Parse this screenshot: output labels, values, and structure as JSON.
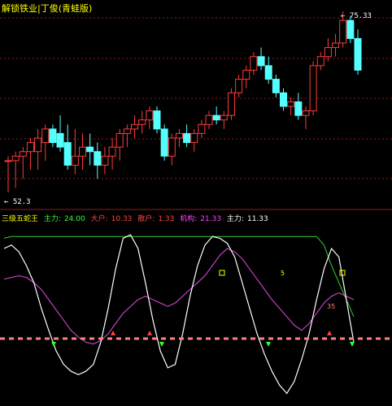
{
  "upper_panel": {
    "title": "解锁铁业|丁俊(青蛙版)",
    "high_label": "← 75.33",
    "low_label": "← 52.3",
    "colors": {
      "up": "#ff3b3b",
      "down": "#54ffff",
      "grid": "#8a1e1e",
      "title": "#ffff00"
    }
  },
  "lower_panel": {
    "indicator_name": "三级五蛇王",
    "fields": [
      {
        "label": "主力:",
        "value": "24.00",
        "color": "#33ff33"
      },
      {
        "label": "大户:",
        "value": "10.33",
        "color": "#ff4444"
      },
      {
        "label": "散户:",
        "value": "1.33",
        "color": "#ff4444"
      },
      {
        "label": "机构:",
        "value": "21.33",
        "color": "#ff44ff"
      },
      {
        "label": "主力:",
        "value": "11.33",
        "color": "#ffffff"
      }
    ],
    "marker_labels": [
      "5",
      "35"
    ],
    "colors": {
      "white_line": "#ffffff",
      "magenta_line": "#c040c0",
      "green_line": "#33cc33",
      "dash_line": "#ff8080",
      "buy_arrow": "#33ff33",
      "sell_arrow": "#ff4040"
    }
  },
  "chart_data": {
    "type": "candlestick",
    "candles": [
      {
        "o": 64,
        "h": 65,
        "l": 57,
        "c": 64
      },
      {
        "o": 64,
        "h": 66,
        "l": 58,
        "c": 65
      },
      {
        "o": 65,
        "h": 67,
        "l": 60,
        "c": 66
      },
      {
        "o": 66,
        "h": 69,
        "l": 62,
        "c": 68
      },
      {
        "o": 66,
        "h": 71,
        "l": 62,
        "c": 69
      },
      {
        "o": 68,
        "h": 72,
        "l": 64,
        "c": 71
      },
      {
        "o": 71,
        "h": 72,
        "l": 67,
        "c": 68
      },
      {
        "o": 70,
        "h": 74,
        "l": 66,
        "c": 67
      },
      {
        "o": 68,
        "h": 72,
        "l": 62,
        "c": 63
      },
      {
        "o": 63,
        "h": 71,
        "l": 61,
        "c": 65
      },
      {
        "o": 65,
        "h": 70,
        "l": 62,
        "c": 67
      },
      {
        "o": 67,
        "h": 70,
        "l": 63,
        "c": 66
      },
      {
        "o": 66,
        "h": 68,
        "l": 60,
        "c": 63
      },
      {
        "o": 63,
        "h": 67,
        "l": 61,
        "c": 65
      },
      {
        "o": 65,
        "h": 69,
        "l": 62,
        "c": 67
      },
      {
        "o": 67,
        "h": 71,
        "l": 64,
        "c": 70
      },
      {
        "o": 70,
        "h": 72,
        "l": 67,
        "c": 71
      },
      {
        "o": 71,
        "h": 74,
        "l": 69,
        "c": 72
      },
      {
        "o": 72,
        "h": 75,
        "l": 70,
        "c": 73
      },
      {
        "o": 73,
        "h": 76,
        "l": 71,
        "c": 75
      },
      {
        "o": 75,
        "h": 76,
        "l": 70,
        "c": 71
      },
      {
        "o": 71,
        "h": 72,
        "l": 64,
        "c": 65
      },
      {
        "o": 65,
        "h": 70,
        "l": 63,
        "c": 69
      },
      {
        "o": 69,
        "h": 71,
        "l": 67,
        "c": 70
      },
      {
        "o": 70,
        "h": 72,
        "l": 67,
        "c": 68
      },
      {
        "o": 68,
        "h": 71,
        "l": 66,
        "c": 70
      },
      {
        "o": 70,
        "h": 73,
        "l": 69,
        "c": 72
      },
      {
        "o": 72,
        "h": 75,
        "l": 71,
        "c": 74
      },
      {
        "o": 74,
        "h": 76,
        "l": 72,
        "c": 73
      },
      {
        "o": 73,
        "h": 75,
        "l": 71,
        "c": 74
      },
      {
        "o": 74,
        "h": 80,
        "l": 73,
        "c": 79
      },
      {
        "o": 79,
        "h": 83,
        "l": 78,
        "c": 82
      },
      {
        "o": 82,
        "h": 85,
        "l": 80,
        "c": 84
      },
      {
        "o": 84,
        "h": 88,
        "l": 83,
        "c": 87
      },
      {
        "o": 87,
        "h": 89,
        "l": 84,
        "c": 85
      },
      {
        "o": 85,
        "h": 87,
        "l": 81,
        "c": 82
      },
      {
        "o": 82,
        "h": 83,
        "l": 78,
        "c": 79
      },
      {
        "o": 79,
        "h": 80,
        "l": 75,
        "c": 76
      },
      {
        "o": 76,
        "h": 78,
        "l": 74,
        "c": 77
      },
      {
        "o": 77,
        "h": 79,
        "l": 73,
        "c": 74
      },
      {
        "o": 74,
        "h": 76,
        "l": 71,
        "c": 75
      },
      {
        "o": 75,
        "h": 86,
        "l": 74,
        "c": 85
      },
      {
        "o": 85,
        "h": 88,
        "l": 84,
        "c": 87
      },
      {
        "o": 87,
        "h": 91,
        "l": 86,
        "c": 89
      },
      {
        "o": 89,
        "h": 92,
        "l": 87,
        "c": 90
      },
      {
        "o": 90,
        "h": 97,
        "l": 89,
        "c": 95
      },
      {
        "o": 95,
        "h": 96,
        "l": 90,
        "c": 91
      },
      {
        "o": 91,
        "h": 93,
        "l": 83,
        "c": 84
      }
    ]
  }
}
